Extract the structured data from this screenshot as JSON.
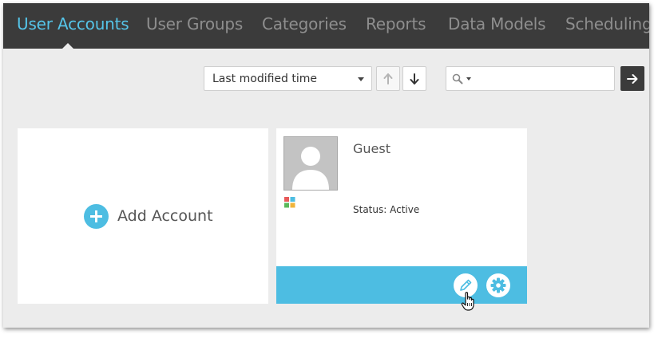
{
  "nav": {
    "tabs": [
      {
        "label": "User Accounts",
        "active": true
      },
      {
        "label": "User Groups",
        "active": false
      },
      {
        "label": "Categories",
        "active": false
      },
      {
        "label": "Reports",
        "active": false
      },
      {
        "label": "Data Models",
        "active": false
      },
      {
        "label": "Scheduling",
        "active": false
      }
    ]
  },
  "toolbar": {
    "sort": {
      "selected": "Last modified time"
    },
    "search": {
      "value": "",
      "placeholder": ""
    }
  },
  "cards": {
    "add_account_label": "Add Account",
    "user": {
      "name": "Guest",
      "status": "Status: Active"
    }
  },
  "colors": {
    "accent": "#4dbde2",
    "nav_background": "#3b3b3b",
    "active_tab": "#55c4e8"
  }
}
